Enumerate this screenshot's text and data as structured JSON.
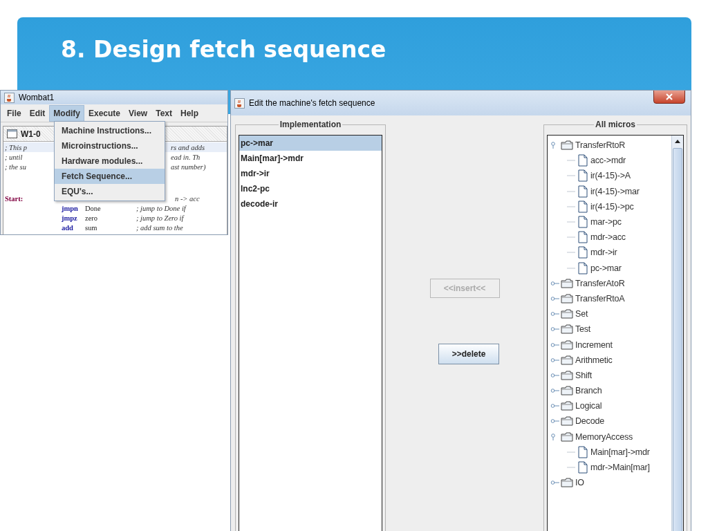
{
  "slide": {
    "title": "8. Design fetch sequence"
  },
  "main_window": {
    "title": "Wombat1",
    "menu": [
      {
        "label": "File",
        "selected": false
      },
      {
        "label": "Edit",
        "selected": false
      },
      {
        "label": "Modify",
        "selected": true
      },
      {
        "label": "Execute",
        "selected": false
      },
      {
        "label": "View",
        "selected": false
      },
      {
        "label": "Text",
        "selected": false
      },
      {
        "label": "Help",
        "selected": false
      }
    ],
    "dropdown": [
      {
        "label": "Machine Instructions...",
        "selected": false
      },
      {
        "label": "Microinstructions...",
        "selected": false
      },
      {
        "label": "Hardware modules...",
        "selected": false
      },
      {
        "label": "Fetch Sequence...",
        "selected": true
      },
      {
        "label": "EQU's...",
        "selected": false
      }
    ],
    "document": {
      "title": "W1-0",
      "lines": [
        {
          "kind": "comment",
          "left": "; This p",
          "right": "rs and adds"
        },
        {
          "kind": "comment",
          "left": "; until",
          "right": "ead in.  Th"
        },
        {
          "kind": "comment",
          "left": "; the su",
          "right": "ast number)"
        },
        {
          "kind": "blank"
        },
        {
          "kind": "label",
          "left": "Start:",
          "right": "n -> acc"
        },
        {
          "kind": "instr",
          "op": "jmpn",
          "arg": "Done",
          "comment": "; jump to Done if"
        },
        {
          "kind": "instr",
          "op": "jmpz",
          "arg": "zero",
          "comment": "; jump to Zero if"
        },
        {
          "kind": "instr",
          "op": "add",
          "arg": "sum",
          "comment": "; add sum to the"
        }
      ]
    }
  },
  "dialog": {
    "title": "Edit the machine's fetch sequence",
    "implementation": {
      "title": "Implementation",
      "items": [
        {
          "label": "pc->mar",
          "selected": true
        },
        {
          "label": "Main[mar]->mdr",
          "selected": false
        },
        {
          "label": "mdr->ir",
          "selected": false
        },
        {
          "label": "Inc2-pc",
          "selected": false
        },
        {
          "label": "decode-ir",
          "selected": false
        }
      ]
    },
    "buttons": [
      {
        "label": "<<insert<<",
        "disabled": true
      },
      {
        "label": ">>delete",
        "disabled": false
      }
    ],
    "all_micros": {
      "title": "All micros",
      "tree": [
        {
          "label": "TransferRtoR",
          "expanded": true,
          "children": [
            {
              "label": "acc->mdr"
            },
            {
              "label": "ir(4-15)->A"
            },
            {
              "label": "ir(4-15)->mar"
            },
            {
              "label": "ir(4-15)->pc"
            },
            {
              "label": "mar->pc"
            },
            {
              "label": "mdr->acc"
            },
            {
              "label": "mdr->ir"
            },
            {
              "label": "pc->mar"
            }
          ]
        },
        {
          "label": "TransferAtoR",
          "expanded": false
        },
        {
          "label": "TransferRtoA",
          "expanded": false
        },
        {
          "label": "Set",
          "expanded": false
        },
        {
          "label": "Test",
          "expanded": false
        },
        {
          "label": "Increment",
          "expanded": false
        },
        {
          "label": "Arithmetic",
          "expanded": false
        },
        {
          "label": "Shift",
          "expanded": false
        },
        {
          "label": "Branch",
          "expanded": false
        },
        {
          "label": "Logical",
          "expanded": false
        },
        {
          "label": "Decode",
          "expanded": false
        },
        {
          "label": "MemoryAccess",
          "expanded": true,
          "children": [
            {
              "label": "Main[mar]->mdr"
            },
            {
              "label": "mdr->Main[mar]"
            }
          ]
        },
        {
          "label": "IO",
          "expanded": false
        }
      ]
    }
  }
}
